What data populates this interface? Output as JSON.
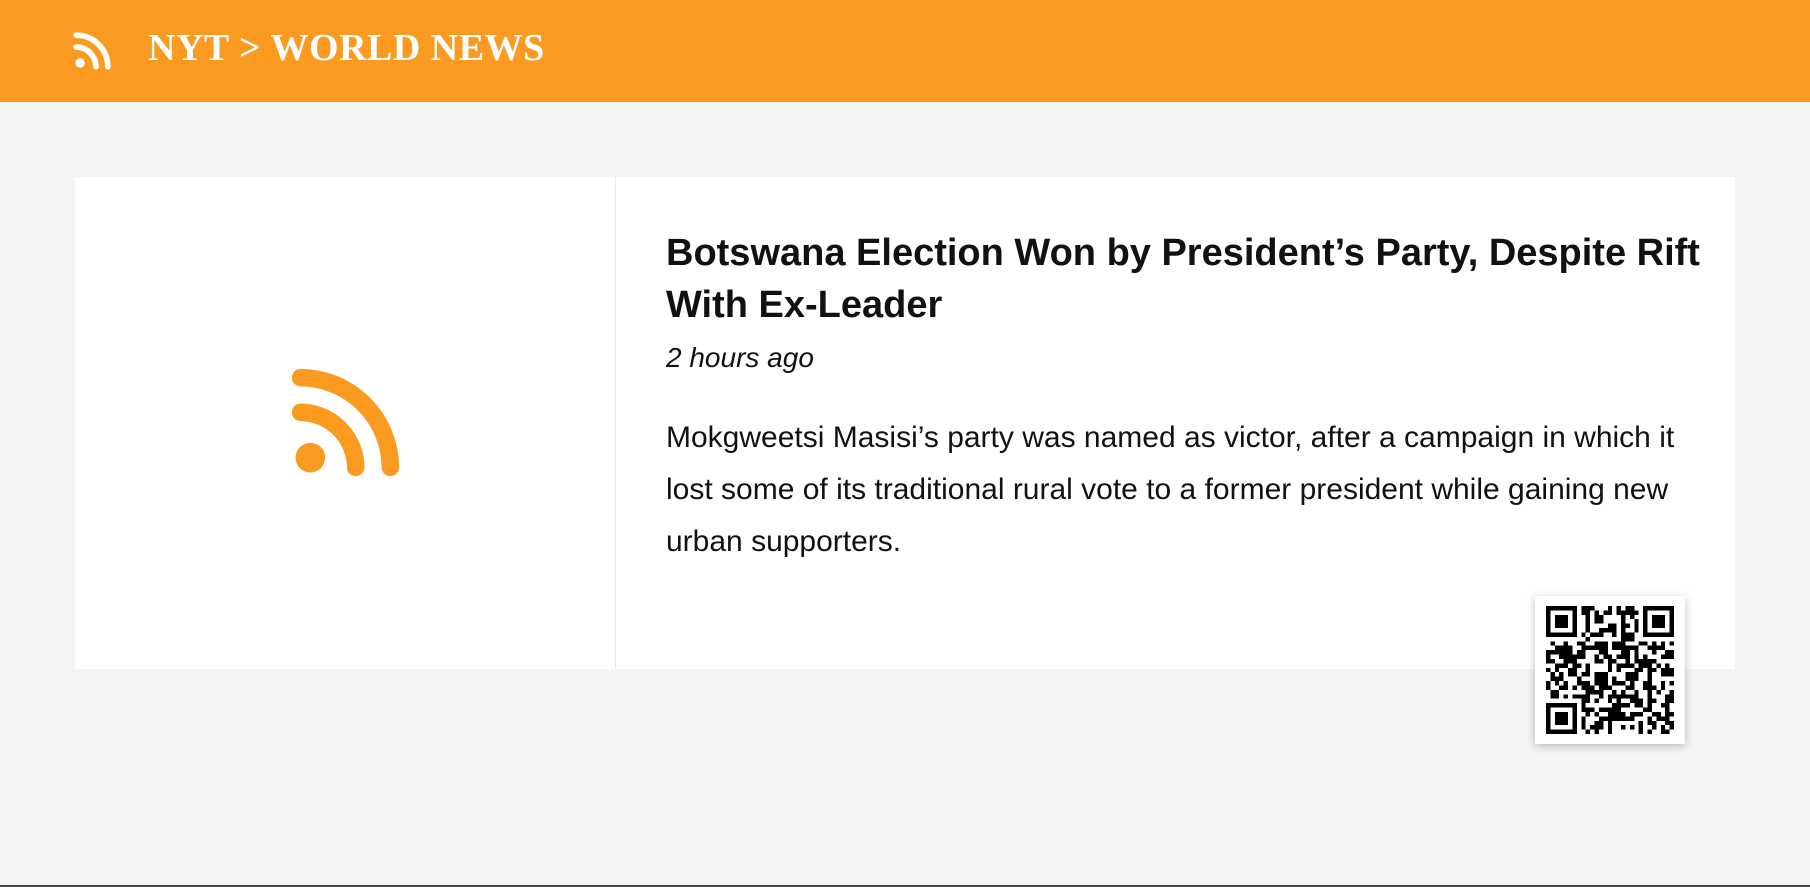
{
  "header": {
    "feed_icon": "rss-icon",
    "title": "NYT > WORLD NEWS"
  },
  "article": {
    "thumbnail_icon": "rss-icon",
    "headline": "Botswana Election Won by President’s Party, Despite Rift With Ex-Leader",
    "timestamp": "2 hours ago",
    "summary": "Mokgweetsi Masisi’s party was named as victor, after a campaign in which it lost some of its traditional rural vote to a former president while gaining new urban supporters."
  },
  "qr_code": {
    "icon": "qr-code-icon"
  },
  "colors": {
    "accent": "#fa9a21",
    "background": "#f4f4f4",
    "card": "#ffffff",
    "text": "#111111"
  }
}
